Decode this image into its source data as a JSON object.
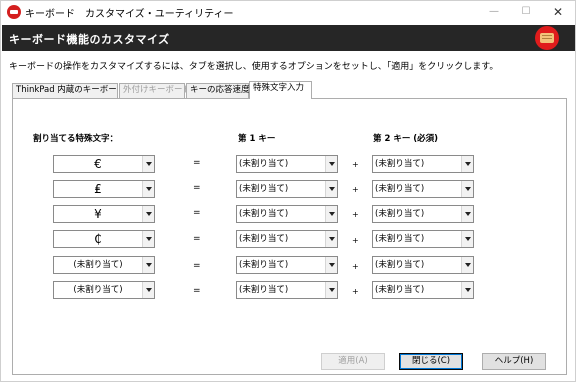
{
  "window": {
    "title": "キーボード　カスタマイズ・ユーティリティー",
    "minimize": "—",
    "maximize": "☐",
    "close": "✕"
  },
  "header": {
    "title": "キーボード機能のカスタマイズ",
    "icon": "keyboard-icon"
  },
  "description": "キーボードの操作をカスタマイズするには、タブを選択し、使用するオプションをセットし、「適用」をクリックします。",
  "tabs": [
    {
      "label": "ThinkPad 内蔵のキーボード",
      "state": "normal"
    },
    {
      "label": "外付けキーボード",
      "state": "disabled"
    },
    {
      "label": "キーの応答速度",
      "state": "normal"
    },
    {
      "label": "特殊文字入力",
      "state": "active"
    }
  ],
  "columns": {
    "char": "割り当てる特殊文字：",
    "key1": "第 1 キー",
    "key2": "第 2 キー (必須)"
  },
  "rows": [
    {
      "char": "€",
      "eq": "=",
      "key1": "(未割り当て)",
      "plus": "+",
      "key2": "(未割り当て)"
    },
    {
      "char": "₤",
      "eq": "=",
      "key1": "(未割り当て)",
      "plus": "+",
      "key2": "(未割り当て)"
    },
    {
      "char": "¥",
      "eq": "=",
      "key1": "(未割り当て)",
      "plus": "+",
      "key2": "(未割り当て)"
    },
    {
      "char": "₵",
      "eq": "=",
      "key1": "(未割り当て)",
      "plus": "+",
      "key2": "(未割り当て)"
    },
    {
      "char": "(未割り当て)",
      "eq": "=",
      "key1": "(未割り当て)",
      "plus": "+",
      "key2": "(未割り当て)"
    },
    {
      "char": "(未割り当て)",
      "eq": "=",
      "key1": "(未割り当て)",
      "plus": "+",
      "key2": "(未割り当て)"
    }
  ],
  "buttons": {
    "apply": "適用(A)",
    "close": "閉じる(C)",
    "help": "ヘルプ(H)"
  }
}
